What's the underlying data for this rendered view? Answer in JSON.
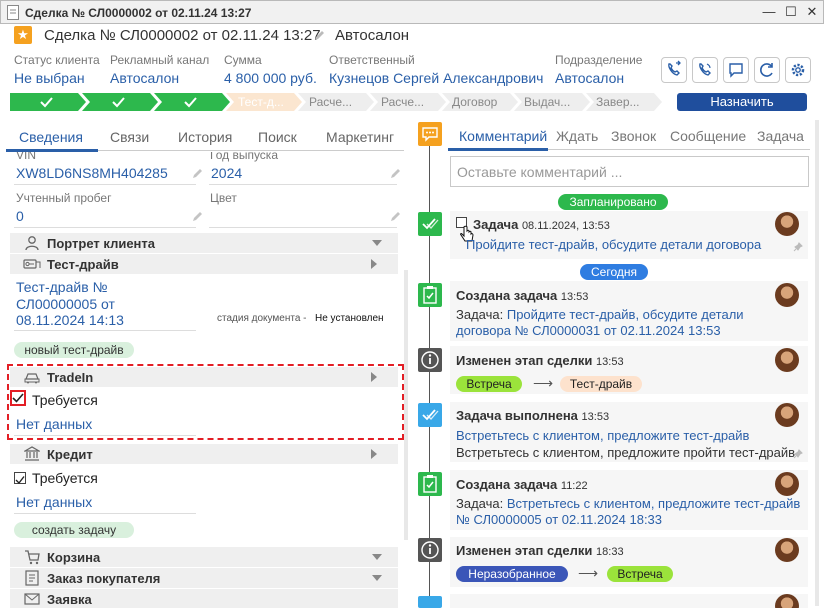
{
  "window": {
    "title": "Сделка № СЛ0000002 от 02.11.24 13:27",
    "min": "—",
    "max": "☐",
    "close": "✕"
  },
  "header": {
    "title": "Сделка № СЛ0000002 от 02.11.24 13:27",
    "subtitle": "Автосалон"
  },
  "fields": [
    {
      "label": "Статус клиента",
      "value": "Не выбран"
    },
    {
      "label": "Рекламный канал",
      "value": "Автосалон"
    },
    {
      "label": "Сумма",
      "value": "4 800 000 руб."
    },
    {
      "label": "Ответственный",
      "value": "Кузнецов Сергей Александрович"
    },
    {
      "label": "Подразделение",
      "value": "Автосалон"
    }
  ],
  "stages": [
    "Тест-д...",
    "Расче...",
    "Расче...",
    "Договор",
    "Выдач...",
    "Завер..."
  ],
  "assign_label": "Назначить",
  "left_tabs": [
    "Сведения",
    "Связи",
    "История",
    "Поиск",
    "Маркетинг"
  ],
  "details": {
    "vin_label": "VIN",
    "vin": "XW8LD6NS8MH404285",
    "year_label": "Год выпуска",
    "year": "2024",
    "mileage_label": "Учтенный пробег",
    "mileage": "0",
    "color_label": "Цвет"
  },
  "sections": {
    "portrait": "Портрет клиента",
    "testdrive": "Тест-драйв",
    "tradein": "TradeIn",
    "credit": "Кредит",
    "cart": "Корзина",
    "order": "Заказ покупателя",
    "request": "Заявка"
  },
  "testdrive": {
    "doc_line1": "Тест-драйв №",
    "doc_line2": "СЛ00000005 от",
    "doc_line3": "08.11.2024 14:13",
    "stage_label": "стадия документа -",
    "stage_value": "Не установлен",
    "new_label": "новый тест-драйв"
  },
  "tradein": {
    "required": "Требуется",
    "no_data": "Нет данных"
  },
  "credit": {
    "required": "Требуется",
    "no_data": "Нет данных",
    "create_task": "создать задачу"
  },
  "right_tabs": [
    "Комментарий",
    "Ждать",
    "Звонок",
    "Сообщение",
    "Задача"
  ],
  "comment_placeholder": "Оставьте комментарий ...",
  "badges": {
    "planned": "Запланировано",
    "today": "Сегодня"
  },
  "timeline": [
    {
      "title": "Задача",
      "time": "08.11.2024, 13:53",
      "line1": "Пройдите тест-драйв, обсудите детали договора"
    },
    {
      "title": "Создана задача",
      "time": "13:53",
      "prefix": "Задача:",
      "line1": "Пройдите тест-драйв, обсудите детали",
      "line2": "договора № СЛ0000031 от 02.11.2024 13:53"
    },
    {
      "title": "Изменен этап сделки",
      "time": "13:53",
      "from": "Встреча",
      "to": "Тест-драйв"
    },
    {
      "title": "Задача выполнена",
      "time": "13:53",
      "line1": "Встретьтесь с клиентом, предложите тест-драйв",
      "line2": "Встретьтесь с клиентом, предложите пройти тест-драйв"
    },
    {
      "title": "Создана задача",
      "time": "11:22",
      "prefix": "Задача:",
      "line1": "Встретьтесь с клиентом, предложите тест-драйв",
      "line2": "№ СЛ0000005 от 02.11.2024 18:33"
    },
    {
      "title": "Изменен этап сделки",
      "time": "18:33",
      "from": "Неразобранное",
      "to": "Встреча"
    }
  ],
  "colors": {
    "accent": "#2a5fa8",
    "green": "#2db84d",
    "orange": "#f5a11f",
    "red": "#e31e25",
    "navy": "#1f4e9d"
  }
}
